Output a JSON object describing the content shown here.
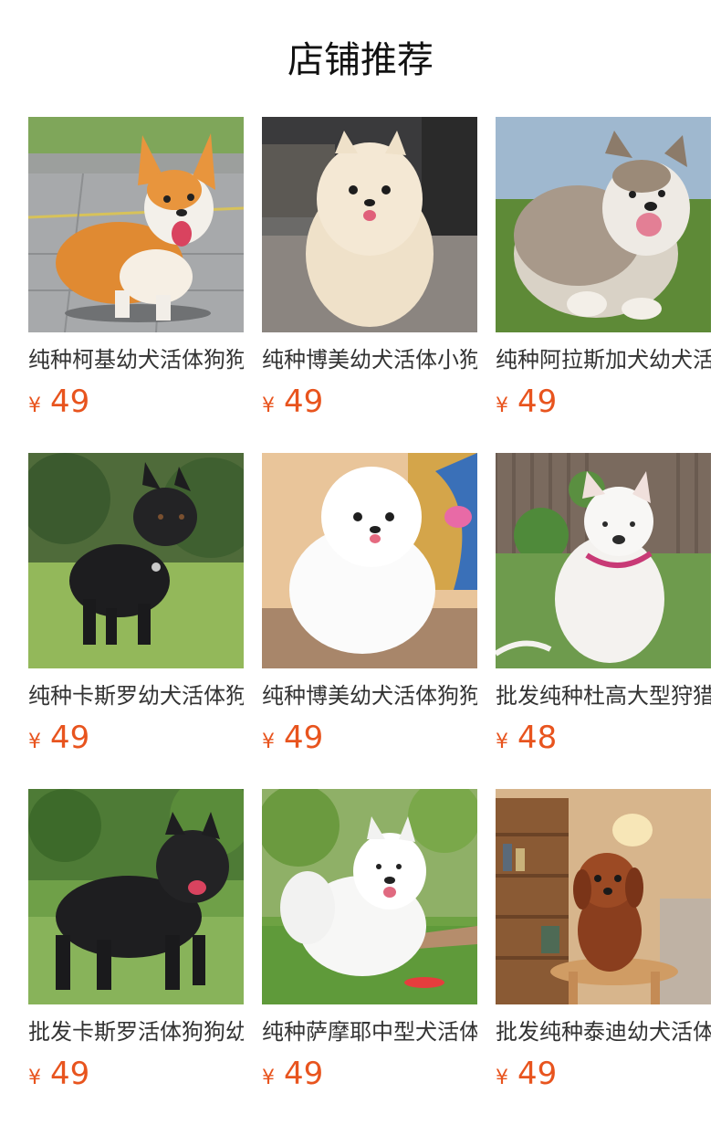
{
  "section": {
    "title": "店铺推荐"
  },
  "accent_color": "#e8541e",
  "products": [
    {
      "name": "纯种柯基幼犬活体狗狗",
      "currency": "¥",
      "price": "49",
      "image": "corgi-puppy"
    },
    {
      "name": "纯种博美幼犬活体小狗",
      "currency": "¥",
      "price": "49",
      "image": "pomeranian-puppy"
    },
    {
      "name": "纯种阿拉斯加犬幼犬活体",
      "currency": "¥",
      "price": "49",
      "image": "alaskan-puppy"
    },
    {
      "name": "纯种卡斯罗幼犬活体狗狗",
      "currency": "¥",
      "price": "49",
      "image": "cane-corso-puppy"
    },
    {
      "name": "纯种博美幼犬活体狗狗",
      "currency": "¥",
      "price": "49",
      "image": "white-pomeranian-puppy"
    },
    {
      "name": "批发纯种杜高大型狩猎犬",
      "currency": "¥",
      "price": "48",
      "image": "dogo-argentino"
    },
    {
      "name": "批发卡斯罗活体狗狗幼犬",
      "currency": "¥",
      "price": "49",
      "image": "black-cane-corso"
    },
    {
      "name": "纯种萨摩耶中型犬活体",
      "currency": "¥",
      "price": "49",
      "image": "samoyed"
    },
    {
      "name": "批发纯种泰迪幼犬活体",
      "currency": "¥",
      "price": "49",
      "image": "teddy-poodle"
    }
  ]
}
